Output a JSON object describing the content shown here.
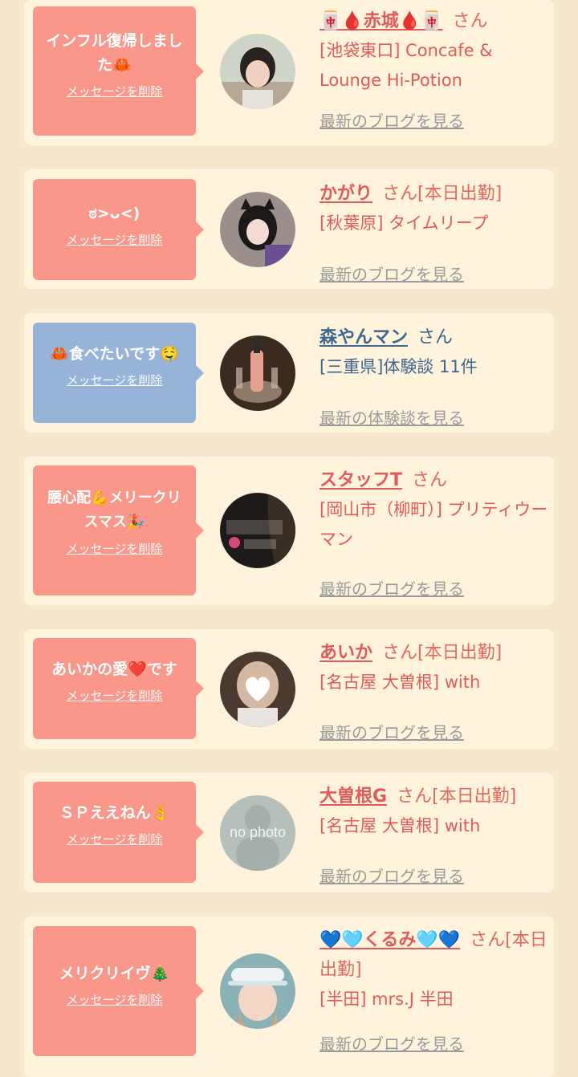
{
  "items": [
    {
      "message": "インフル復帰しました🦀",
      "delete_label": "メッセージを削除",
      "bubble_color": "pink",
      "avatar_icon": "avatar-photo-girl-short-hair",
      "name": "🀄🩸赤城🩸🀄",
      "suffix": "さん",
      "shop": "[池袋東口] Concafe & Lounge Hi-Potion",
      "link": "最新のブログを見る"
    },
    {
      "message": "ಠ>ᴗ<)",
      "delete_label": "メッセージを削除",
      "bubble_color": "pink",
      "avatar_icon": "avatar-photo-girl-cat-ears",
      "name": "かがり",
      "suffix": "さん[本日出勤]",
      "shop": "[秋葉原] タイムリープ",
      "link": "最新のブログを見る"
    },
    {
      "message": "🦀食べたいです🤤",
      "delete_label": "メッセージを削除",
      "bubble_color": "blue",
      "avatar_icon": "avatar-photo-champagne",
      "name": "森やんマン",
      "suffix": "さん",
      "shop": "[三重県]体験談 11件",
      "link": "最新の体験談を見る"
    },
    {
      "message": "腰心配💪メリークリスマス🎉",
      "delete_label": "メッセージを削除",
      "bubble_color": "pink",
      "avatar_icon": "avatar-logo-pretty-woman",
      "name": "スタッフT",
      "suffix": "さん",
      "shop": "[岡山市（柳町）] プリティウーマン",
      "link": "最新のブログを見る"
    },
    {
      "message": "あいかの愛❤️です",
      "delete_label": "メッセージを削除",
      "bubble_color": "pink",
      "avatar_icon": "avatar-photo-heart-face",
      "name": "あいか",
      "suffix": "さん[本日出勤]",
      "shop": "[名古屋 大曽根] with",
      "link": "最新のブログを見る"
    },
    {
      "message": "ＳＰええねん👌",
      "delete_label": "メッセージを削除",
      "bubble_color": "pink",
      "avatar_icon": "avatar-no-photo",
      "avatar_text": "no photo",
      "name": "大曽根G",
      "suffix": "さん[本日出勤]",
      "shop": "[名古屋 大曽根] with",
      "link": "最新のブログを見る"
    },
    {
      "message": "メリクリイヴ🎄",
      "delete_label": "メッセージを削除",
      "bubble_color": "pink",
      "avatar_icon": "avatar-photo-girl-visor",
      "name": "💙🩵くるみ🩵💙",
      "suffix": "さん[本日出勤]",
      "shop": "[半田] mrs.J 半田",
      "link": "最新のブログを見る"
    }
  ],
  "colors": {
    "page_bg": "#f6e8cf",
    "card_bg": "#fff3dc",
    "bubble_pink": "#f8978a",
    "bubble_blue": "#98b3d8",
    "name_pink": "#e05a5a",
    "name_blue": "#3d6790",
    "link_gray": "#9a9a9a"
  }
}
